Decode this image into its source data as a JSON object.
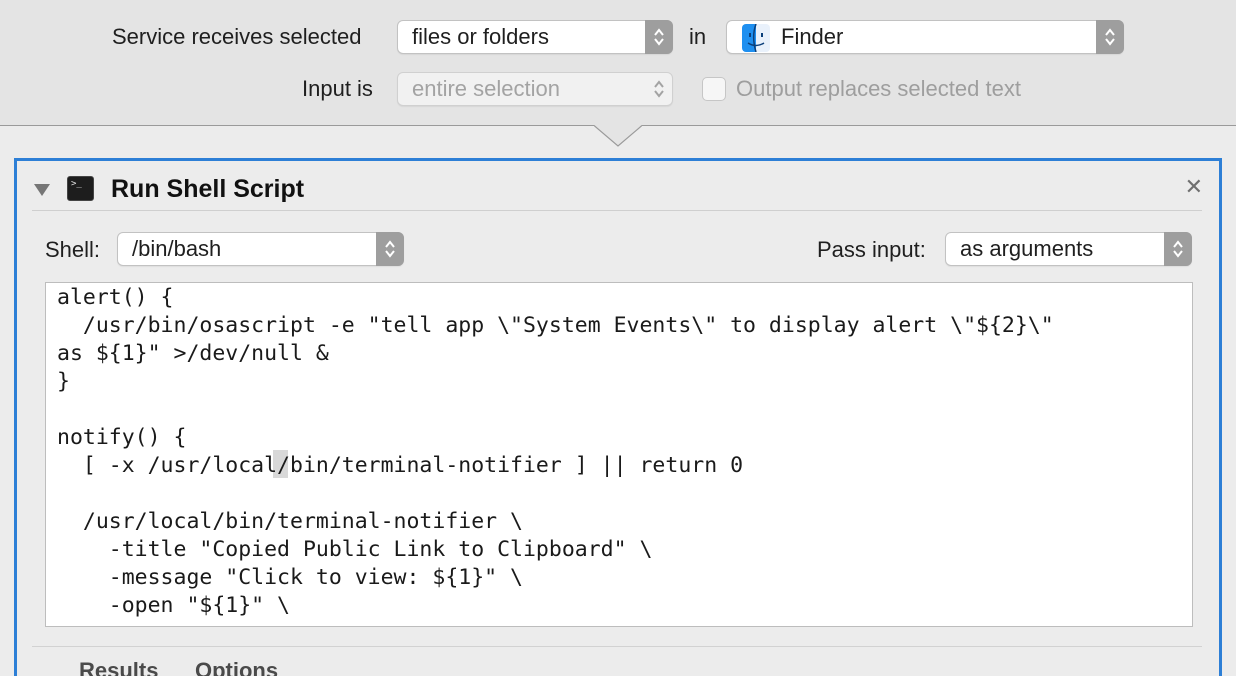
{
  "service": {
    "receives_label": "Service receives selected",
    "receives_value": "files or folders",
    "in_label": "in",
    "app_value": "Finder",
    "app_icon": "finder-icon",
    "input_label": "Input is",
    "input_value": "entire selection",
    "output_replaces_label": "Output replaces selected text",
    "output_replaces_checked": false
  },
  "action": {
    "title": "Run Shell Script",
    "icon": "terminal-icon",
    "close_icon": "close-icon",
    "collapse_icon": "disclosure-triangle-icon",
    "shell_label": "Shell:",
    "shell_value": "/bin/bash",
    "pass_input_label": "Pass input:",
    "pass_input_value": "as arguments",
    "script_lines": [
      "alert() {",
      "  /usr/bin/osascript -e \"tell app \\\"System Events\\\" to display alert \\\"${2}\\\"",
      "as ${1}\" >/dev/null &",
      "}",
      "",
      "notify() {",
      "  [ -x /usr/local/bin/terminal-notifier ] || return 0",
      "",
      "  /usr/local/bin/terminal-notifier \\",
      "    -title \"Copied Public Link to Clipboard\" \\",
      "    -message \"Click to view: ${1}\" \\",
      "    -open \"${1}\" \\"
    ],
    "tabs": [
      "Results",
      "Options"
    ]
  },
  "colors": {
    "accent_border": "#2d7fd6",
    "popup_arrow_bg": "#9e9e9e"
  }
}
